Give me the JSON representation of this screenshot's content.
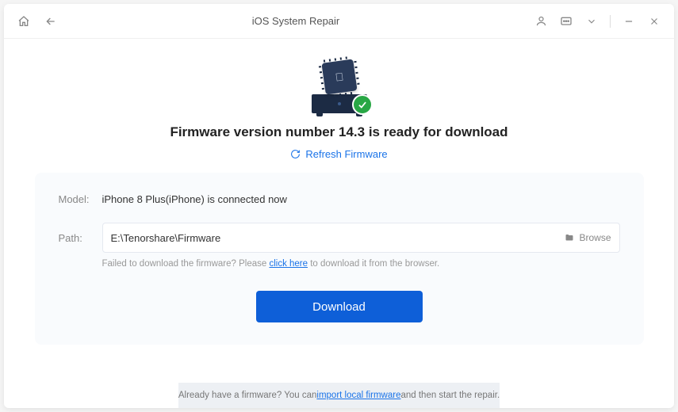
{
  "titlebar": {
    "title": "iOS System Repair"
  },
  "headline": "Firmware version number 14.3 is ready for download",
  "refresh_label": "Refresh Firmware",
  "panel": {
    "model_label": "Model:",
    "model_value": "iPhone 8 Plus(iPhone) is connected now",
    "path_label": "Path:",
    "path_value": "E:\\Tenorshare\\Firmware",
    "browse_label": "Browse",
    "hint_prefix": "Failed to download the firmware? Please ",
    "hint_link": "click here",
    "hint_suffix": " to download it from the browser."
  },
  "download_label": "Download",
  "footer": {
    "prefix": "Already have a firmware? You can ",
    "link": "import local firmware",
    "suffix": " and then start the repair."
  }
}
